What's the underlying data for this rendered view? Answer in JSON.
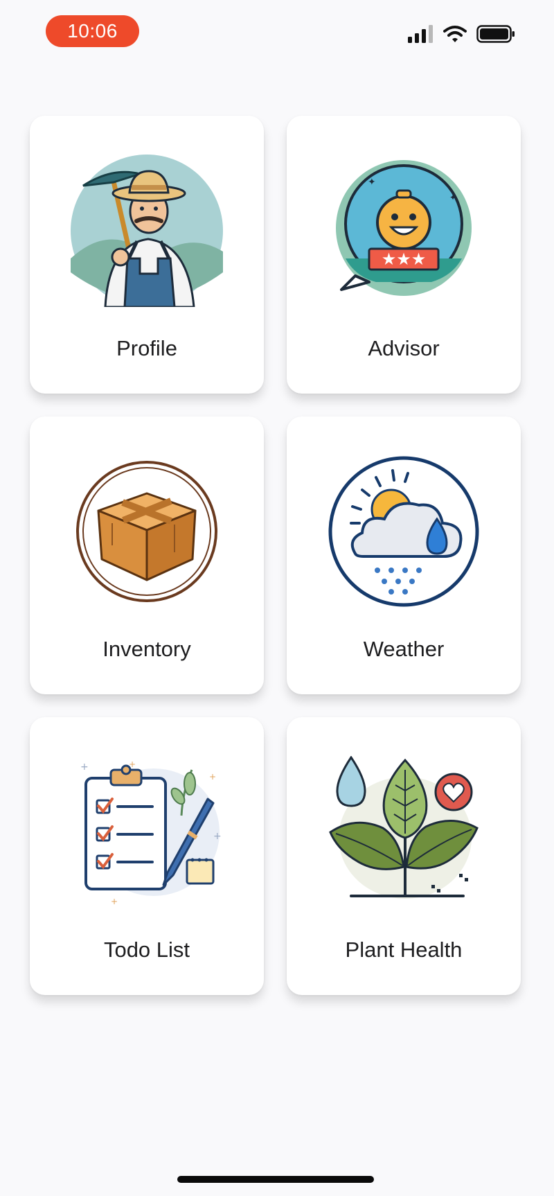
{
  "status_bar": {
    "time": "10:06",
    "icons": [
      "signal-icon",
      "wifi-icon",
      "battery-icon"
    ]
  },
  "tiles": [
    {
      "label": "Profile",
      "icon": "farmer-icon"
    },
    {
      "label": "Advisor",
      "icon": "advisor-chat-icon"
    },
    {
      "label": "Inventory",
      "icon": "box-icon"
    },
    {
      "label": "Weather",
      "icon": "weather-icon"
    },
    {
      "label": "Todo List",
      "icon": "checklist-icon"
    },
    {
      "label": "Plant Health",
      "icon": "plant-health-icon"
    }
  ],
  "colors": {
    "time_pill": "#ee4a2a",
    "background": "#f9f9fb",
    "tile": "#ffffff"
  }
}
